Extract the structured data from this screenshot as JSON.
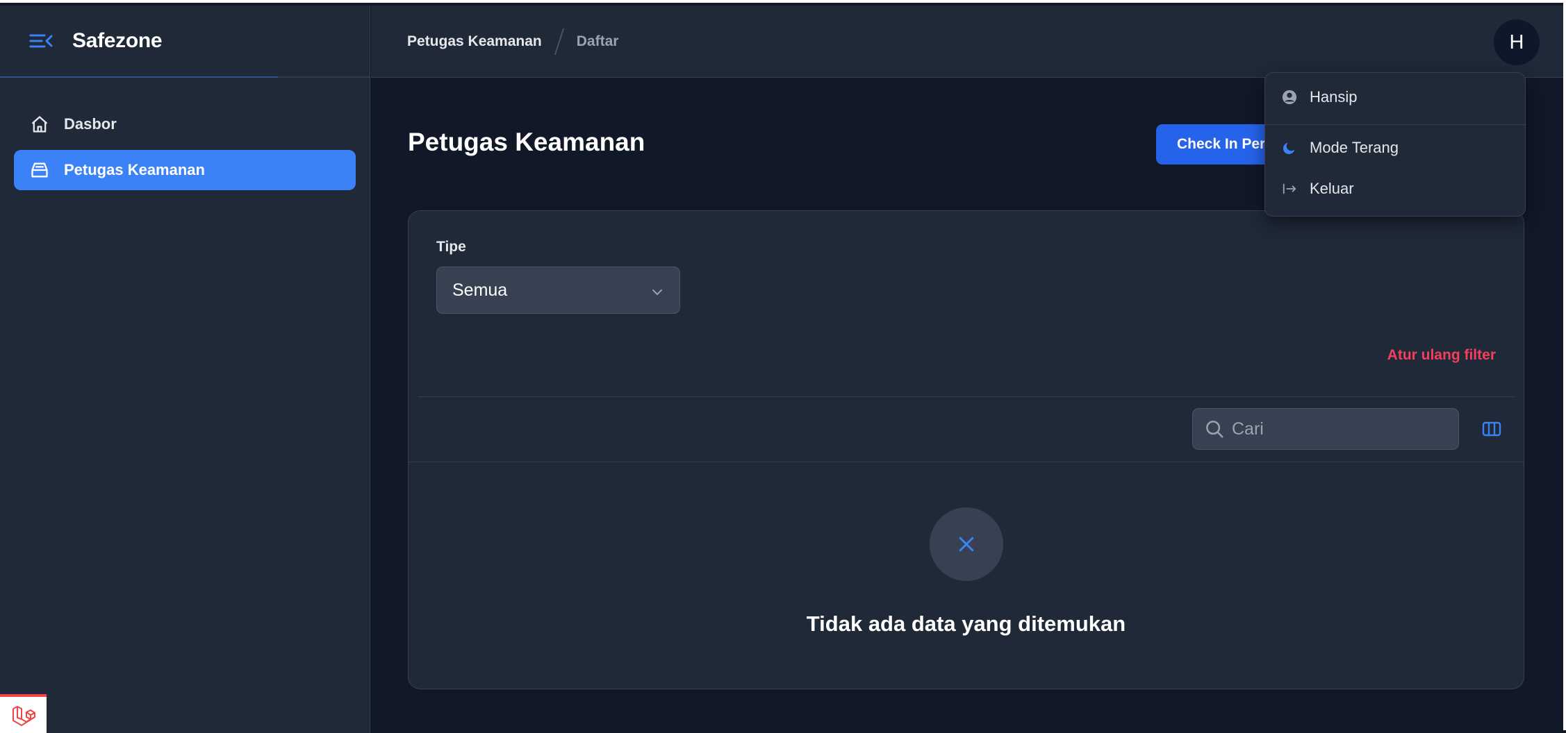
{
  "sidebar": {
    "brand": "Safezone",
    "items": [
      {
        "label": "Dasbor",
        "icon": "home-icon",
        "active": false
      },
      {
        "label": "Petugas Keamanan",
        "icon": "inbox-icon",
        "active": true
      }
    ]
  },
  "header": {
    "breadcrumb": [
      "Petugas Keamanan",
      "Daftar"
    ],
    "avatar_initial": "H"
  },
  "main": {
    "title": "Petugas Keamanan",
    "primary_action_label": "Check In Per",
    "filter": {
      "label": "Tipe",
      "selected": "Semua",
      "reset_label": "Atur ulang filter"
    },
    "search": {
      "placeholder": "Cari"
    },
    "empty_state": {
      "message": "Tidak ada data yang ditemukan"
    }
  },
  "user_menu": {
    "name": "Hansip",
    "items": [
      {
        "label": "Mode Terang",
        "icon": "moon-icon"
      },
      {
        "label": "Keluar",
        "icon": "logout-icon"
      }
    ]
  },
  "colors": {
    "accent": "#3b82f6",
    "primary_button": "#2563eb",
    "danger": "#f43f5e",
    "background": "#111827",
    "surface": "#1f2937"
  }
}
